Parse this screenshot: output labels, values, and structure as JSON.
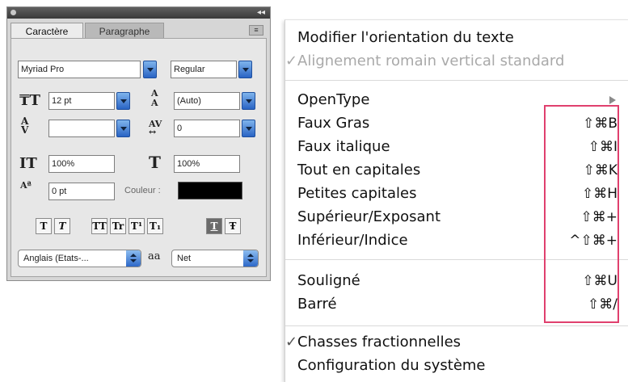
{
  "panel": {
    "collapse_glyph": "◂◂",
    "menu_glyph": "≡",
    "tabs": [
      "Caractère",
      "Paragraphe"
    ],
    "font_family": "Myriad Pro",
    "font_style": "Regular",
    "font_size": "12 pt",
    "leading": "(Auto)",
    "kerning": "",
    "tracking": "0",
    "vertical_scale": "100%",
    "horizontal_scale": "100%",
    "baseline_shift": "0 pt",
    "color_label": "Couleur :",
    "color_value": "#000000",
    "style_buttons": [
      "T",
      "T",
      "TT",
      "Tr",
      "T¹",
      "T₁",
      "T",
      "Ŧ"
    ],
    "language": "Anglais (Etats-...",
    "antialias_icon": "aa",
    "antialias": "Net"
  },
  "menu": {
    "items": [
      {
        "label": "Modifier l'orientation du texte",
        "check": "",
        "shortcut": "",
        "enabled": true
      },
      {
        "label": "Alignement romain vertical standard",
        "check": "✓",
        "shortcut": "",
        "enabled": false
      },
      {
        "label": "OpenType",
        "check": "",
        "shortcut": "",
        "enabled": true,
        "submenu": true
      },
      {
        "label": "Faux Gras",
        "check": "",
        "shortcut": "⇧⌘B",
        "enabled": true
      },
      {
        "label": "Faux italique",
        "check": "",
        "shortcut": "⇧⌘I",
        "enabled": true
      },
      {
        "label": "Tout en capitales",
        "check": "",
        "shortcut": "⇧⌘K",
        "enabled": true
      },
      {
        "label": "Petites capitales",
        "check": "",
        "shortcut": "⇧⌘H",
        "enabled": true
      },
      {
        "label": "Supérieur/Exposant",
        "check": "",
        "shortcut": "⇧⌘+",
        "enabled": true
      },
      {
        "label": "Inférieur/Indice",
        "check": "",
        "shortcut": "^⇧⌘+",
        "enabled": true
      },
      {
        "label": "Souligné",
        "check": "",
        "shortcut": "⇧⌘U",
        "enabled": true
      },
      {
        "label": "Barré",
        "check": "",
        "shortcut": "⇧⌘/",
        "enabled": true
      },
      {
        "label": "Chasses fractionnelles",
        "check": "✓",
        "shortcut": "",
        "enabled": true
      },
      {
        "label": "Configuration du système",
        "check": "",
        "shortcut": "",
        "enabled": true
      }
    ],
    "highlight_color": "#e0406e"
  }
}
